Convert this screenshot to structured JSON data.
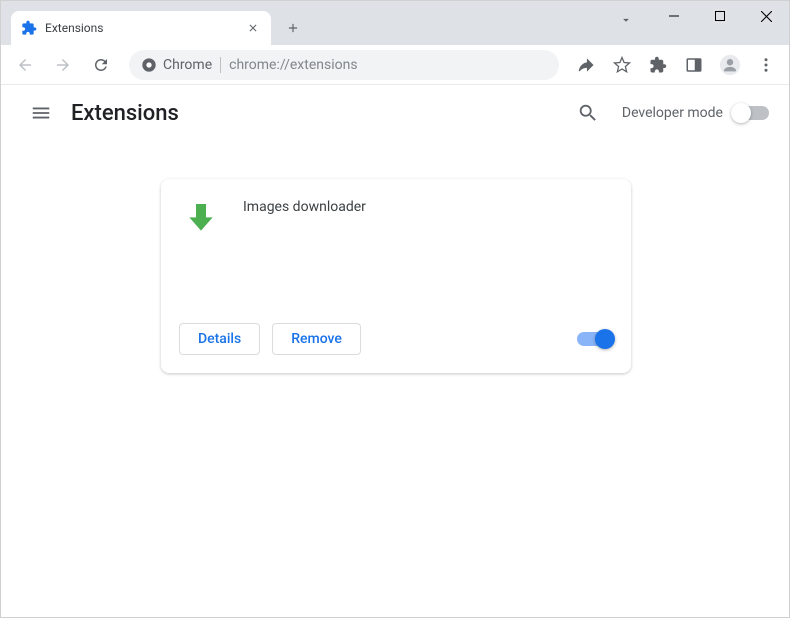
{
  "browser": {
    "tab": {
      "title": "Extensions"
    },
    "address": {
      "prefix": "Chrome",
      "url": "chrome://extensions"
    }
  },
  "page": {
    "title": "Extensions",
    "developer_mode_label": "Developer mode",
    "developer_mode_on": false
  },
  "extension": {
    "name": "Images downloader",
    "details_label": "Details",
    "remove_label": "Remove",
    "enabled": true
  }
}
